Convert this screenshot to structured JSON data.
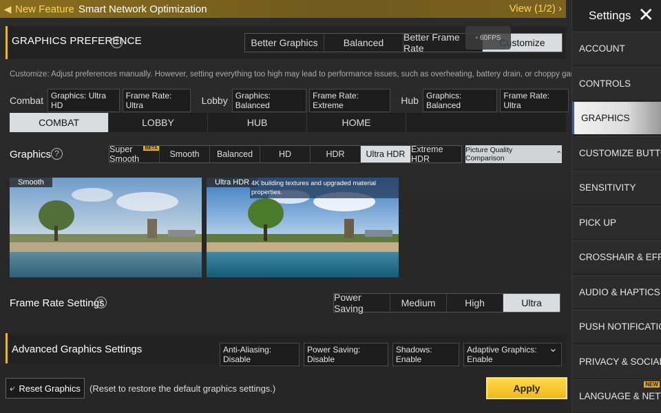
{
  "banner": {
    "prefix": "New Feature",
    "title": "Smart Network Optimization",
    "view": "View (1/2)"
  },
  "pref": {
    "title": "GRAPHICS PREFERENCE",
    "options": [
      "Better Graphics",
      "Balanced",
      "Better Frame Rate",
      "Customize"
    ],
    "active": "Customize",
    "fps_badge": "60FPS"
  },
  "description": "Customize: Adjust preferences manually. However, setting everything too high may lead to performance issues, such as overheating, battery drain, or choppy gameplay.",
  "summary": {
    "combat_label": "Combat",
    "combat_graphics": "Graphics: Ultra HD",
    "combat_fps": "Frame Rate: Ultra",
    "lobby_label": "Lobby",
    "lobby_graphics": "Graphics: Balanced",
    "lobby_fps": "Frame Rate: Extreme",
    "hub_label": "Hub",
    "hub_graphics": "Graphics: Balanced",
    "hub_fps": "Frame Rate: Ultra"
  },
  "tabs": [
    "COMBAT",
    "LOBBY",
    "HUB",
    "HOME"
  ],
  "graphics": {
    "label": "Graphics",
    "options": [
      "Super Smooth",
      "Smooth",
      "Balanced",
      "HD",
      "HDR",
      "Ultra HDR",
      "Extreme HDR"
    ],
    "beta_badge": "BETA",
    "compare_label": "Picture Quality Comparison"
  },
  "preview": {
    "left_label": "Smooth",
    "right_label": "Ultra HDR",
    "right_note": "4K building textures and upgraded material properties."
  },
  "frame_rate": {
    "label": "Frame Rate Settings",
    "options": [
      "Power Saving",
      "Medium",
      "High",
      "Ultra"
    ]
  },
  "advanced": {
    "title": "Advanced Graphics Settings",
    "tags": [
      "Anti-Aliasing: Disable",
      "Power Saving: Disable",
      "Shadows: Enable",
      "Adaptive Graphics: Enable"
    ]
  },
  "bottom": {
    "reset_label": "Reset Graphics",
    "reset_note": "(Reset to restore the default graphics settings.)",
    "apply_label": "Apply"
  },
  "sidebar": {
    "title": "Settings",
    "items": [
      "ACCOUNT",
      "CONTROLS",
      "GRAPHICS",
      "CUSTOMIZE BUTTONS",
      "SENSITIVITY",
      "PICK UP",
      "CROSSHAIR & EFFECTS",
      "AUDIO & HAPTICS",
      "PUSH NOTIFICATIONS",
      "PRIVACY & SOCIAL",
      "LANGUAGE & NETWORK"
    ],
    "new_badge": "NEW"
  },
  "colors": {
    "accent": "#e8b930",
    "apply": "#f5c623",
    "selected": "#d9dde0",
    "sidebar_active_marker": "#3a56c8"
  }
}
